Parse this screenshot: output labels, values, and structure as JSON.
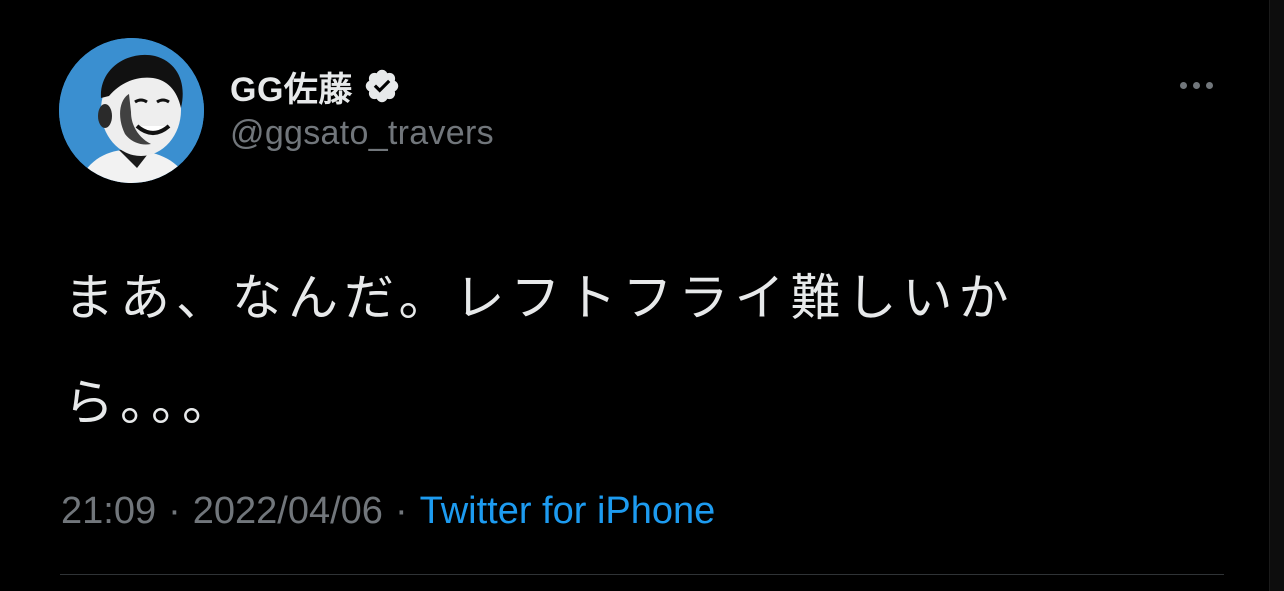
{
  "user": {
    "display_name": "GG佐藤",
    "handle": "@ggsato_travers",
    "verified_icon": "verified-badge-icon",
    "avatar_icon": "avatar-photo"
  },
  "tweet": {
    "text": "まあ、なんだ。レフトフライ難しいから。。。"
  },
  "meta": {
    "time": "21:09",
    "date": "2022/04/06",
    "separator": "·",
    "source": "Twitter for iPhone"
  },
  "actions": {
    "more_icon": "more-options-icon"
  },
  "colors": {
    "background": "#000000",
    "primary_text": "#e7e9ea",
    "secondary_text": "#71767b",
    "link": "#1d9bf0",
    "avatar_bg": "#3a8fd0"
  }
}
